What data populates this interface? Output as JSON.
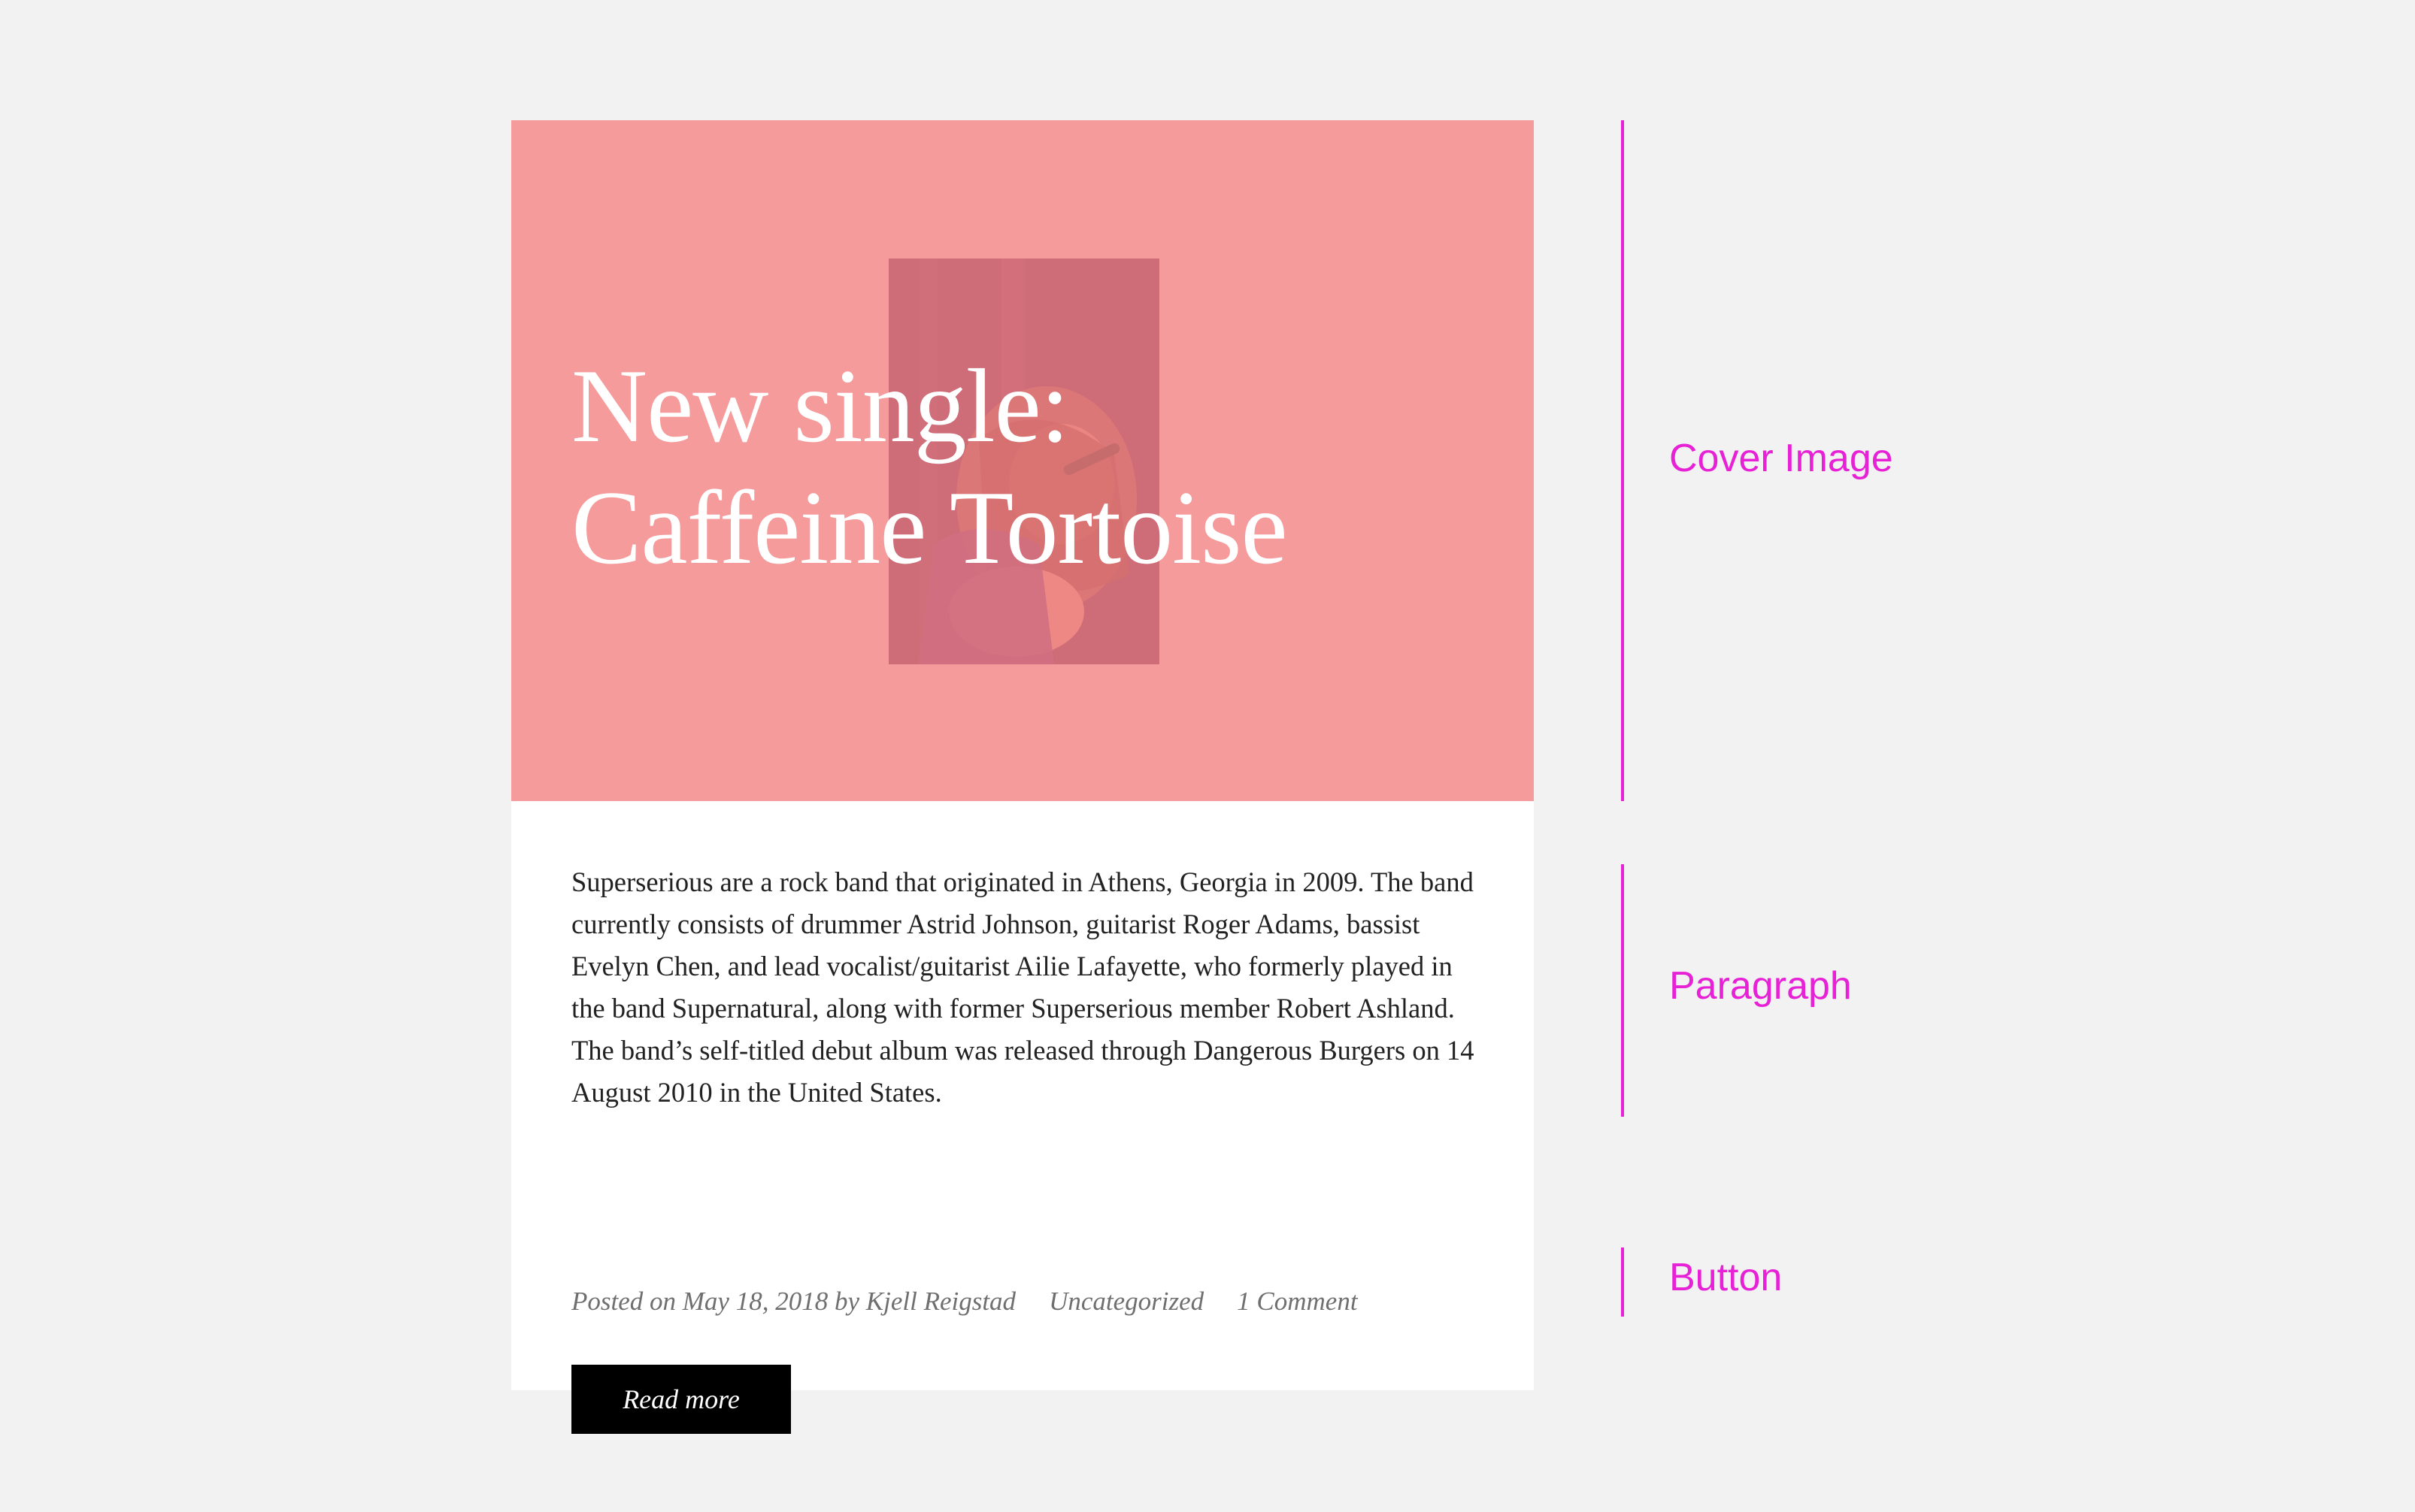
{
  "colors": {
    "page_background": "#f2f2f2",
    "cover_overlay": "#f47f7f",
    "button_background": "#000000",
    "annotation_accent": "#e621d6"
  },
  "card": {
    "cover": {
      "title_line_1": "New single:",
      "title_line_2": "Caffeine Tortoise",
      "photo_icon": "singer-photo"
    },
    "paragraph": "Superserious are a rock band that originated in Athens, Georgia in 2009. The band currently consists of drummer Astrid Johnson, guitarist Roger Adams, bassist Evelyn Chen, and lead vocalist/guitarist Ailie Lafayette, who formerly played in the band Supernatural, along with former Superserious member Robert Ashland. The band’s self-titled debut album was released through Dangerous Burgers on 14 August 2010 in the United States.",
    "meta": {
      "posted_on_prefix": "Posted on",
      "date": "May 18, 2018",
      "by_prefix": "by",
      "author": "Kjell Reigstad",
      "category": "Uncategorized",
      "comments": "1 Comment"
    },
    "button_label": "Read more"
  },
  "annotations": {
    "cover": "Cover Image",
    "paragraph": "Paragraph",
    "button": "Button"
  }
}
